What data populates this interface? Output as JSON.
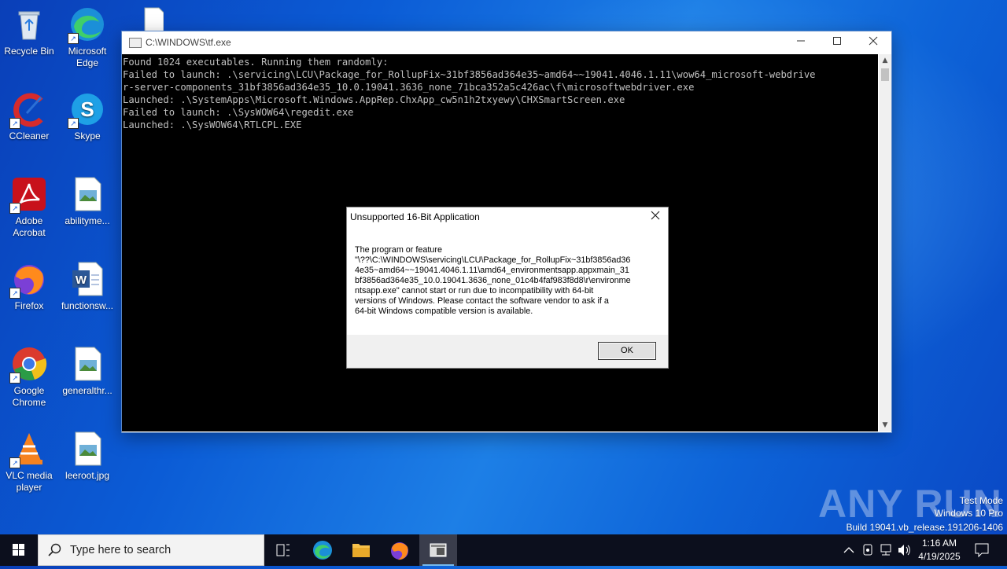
{
  "desktop": {
    "icons": [
      {
        "label": "Recycle Bin"
      },
      {
        "label": "Microsoft Edge"
      },
      {
        "label": "CCleaner"
      },
      {
        "label": "Skype"
      },
      {
        "label": "Adobe Acrobat"
      },
      {
        "label": "abilityme..."
      },
      {
        "label": "Firefox"
      },
      {
        "label": "functionsw..."
      },
      {
        "label": "Google Chrome"
      },
      {
        "label": "generalthr..."
      },
      {
        "label": "VLC media player"
      },
      {
        "label": "leeroot.jpg"
      }
    ]
  },
  "console": {
    "title": "C:\\WINDOWS\\tf.exe",
    "lines": [
      "Found 1024 executables. Running them randomly:",
      "",
      "Failed to launch: .\\servicing\\LCU\\Package_for_RollupFix~31bf3856ad364e35~amd64~~19041.4046.1.11\\wow64_microsoft-webdrive",
      "r-server-components_31bf3856ad364e35_10.0.19041.3636_none_71bca352a5c426ac\\f\\microsoftwebdriver.exe",
      "Launched: .\\SystemApps\\Microsoft.Windows.AppRep.ChxApp_cw5n1h2txyewy\\CHXSmartScreen.exe",
      "Failed to launch: .\\SysWOW64\\regedit.exe",
      "Launched: .\\SysWOW64\\RTLCPL.EXE"
    ]
  },
  "dialog": {
    "title": "Unsupported 16-Bit Application",
    "message": "The program or feature\n\"\\??\\C:\\WINDOWS\\servicing\\LCU\\Package_for_RollupFix~31bf3856ad36\n4e35~amd64~~19041.4046.1.11\\amd64_environmentsapp.appxmain_31\nbf3856ad364e35_10.0.19041.3636_none_01c4b4faf983f8d8\\r\\environme\nntsapp.exe\" cannot start or run due to incompatibility with 64-bit\nversions of Windows. Please contact the software vendor to ask if a\n64-bit Windows compatible version is available.",
    "ok_label": "OK"
  },
  "watermark": {
    "logo": "ANY RUN",
    "line1": "Test Mode",
    "line2": "Windows 10 Pro",
    "line3": "Build 19041.vb_release.191206-1406"
  },
  "taskbar": {
    "search_placeholder": "Type here to search",
    "time": "1:16 AM",
    "date": "4/19/2025"
  }
}
